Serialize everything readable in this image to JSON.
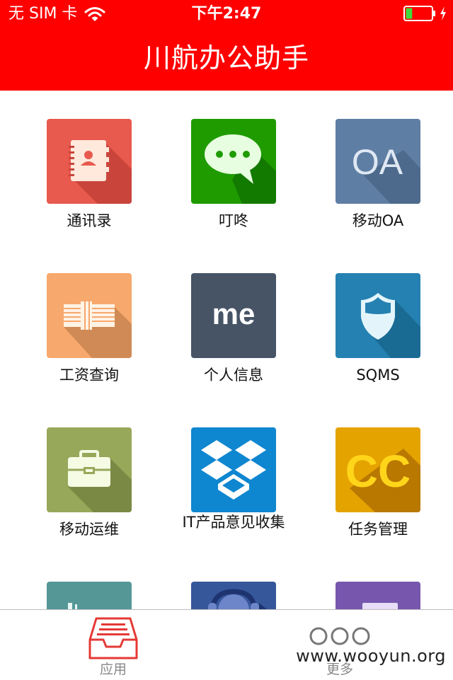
{
  "status_bar": {
    "carrier": "无 SIM 卡",
    "time": "下午2:47",
    "battery_level": 0.25
  },
  "header": {
    "title": "川航办公助手",
    "background_color": "#ff0000"
  },
  "apps": [
    {
      "label": "通讯录",
      "icon": "contacts-book-icon",
      "color": "#e8594e"
    },
    {
      "label": "叮咚",
      "icon": "chat-bubble-icon",
      "color": "#1f9b00"
    },
    {
      "label": "移动OA",
      "icon": "oa-text-icon",
      "icon_text": "OA",
      "color": "#5f7ea4"
    },
    {
      "label": "工资查询",
      "icon": "money-stack-icon",
      "color": "#f7a86d"
    },
    {
      "label": "个人信息",
      "icon": "me-text-icon",
      "icon_text": "me",
      "color": "#465466"
    },
    {
      "label": "SQMS",
      "icon": "shield-icon",
      "color": "#2581b1"
    },
    {
      "label": "移动运维",
      "icon": "toolbox-icon",
      "color": "#98a85a"
    },
    {
      "label": "IT产品意见收集",
      "icon": "dropbox-icon",
      "color": "#0f86d0"
    },
    {
      "label": "任务管理",
      "icon": "cc-text-icon",
      "icon_text": "CC",
      "color": "#e5a300"
    },
    {
      "label": "",
      "icon": "teal-app-icon",
      "color": "#559797"
    },
    {
      "label": "",
      "icon": "headphones-icon",
      "color": "#37579b"
    },
    {
      "label": "",
      "icon": "purple-app-icon",
      "color": "#7657ad"
    }
  ],
  "tab_bar": {
    "tabs": [
      {
        "label": "应用",
        "icon": "inbox-tray-icon",
        "active": true
      },
      {
        "label": "更多",
        "icon": "more-dots-icon",
        "active": false
      }
    ],
    "active_color": "#e53935"
  },
  "watermark": "www.wooyun.org"
}
